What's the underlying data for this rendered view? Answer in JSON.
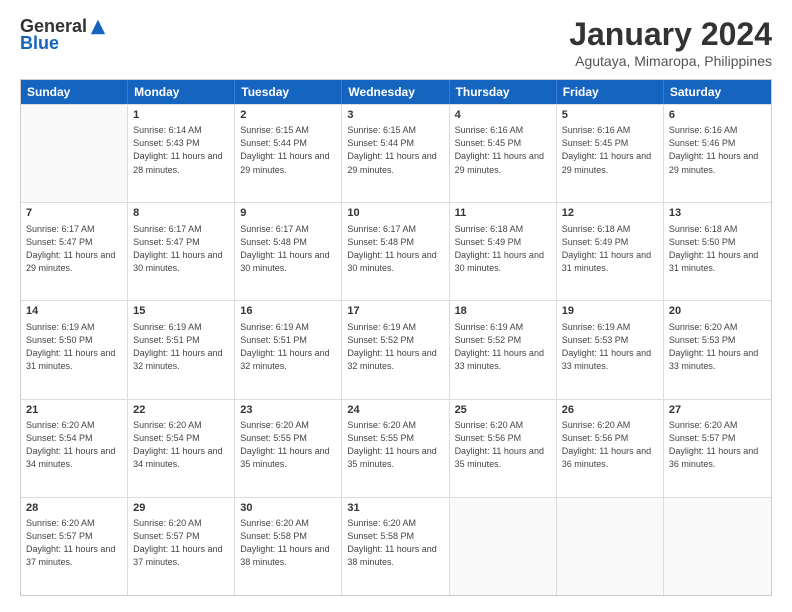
{
  "logo": {
    "general": "General",
    "blue": "Blue"
  },
  "title": "January 2024",
  "subtitle": "Agutaya, Mimaropa, Philippines",
  "header_days": [
    "Sunday",
    "Monday",
    "Tuesday",
    "Wednesday",
    "Thursday",
    "Friday",
    "Saturday"
  ],
  "weeks": [
    [
      {
        "day": "",
        "sunrise": "",
        "sunset": "",
        "daylight": ""
      },
      {
        "day": "1",
        "sunrise": "Sunrise: 6:14 AM",
        "sunset": "Sunset: 5:43 PM",
        "daylight": "Daylight: 11 hours and 28 minutes."
      },
      {
        "day": "2",
        "sunrise": "Sunrise: 6:15 AM",
        "sunset": "Sunset: 5:44 PM",
        "daylight": "Daylight: 11 hours and 29 minutes."
      },
      {
        "day": "3",
        "sunrise": "Sunrise: 6:15 AM",
        "sunset": "Sunset: 5:44 PM",
        "daylight": "Daylight: 11 hours and 29 minutes."
      },
      {
        "day": "4",
        "sunrise": "Sunrise: 6:16 AM",
        "sunset": "Sunset: 5:45 PM",
        "daylight": "Daylight: 11 hours and 29 minutes."
      },
      {
        "day": "5",
        "sunrise": "Sunrise: 6:16 AM",
        "sunset": "Sunset: 5:45 PM",
        "daylight": "Daylight: 11 hours and 29 minutes."
      },
      {
        "day": "6",
        "sunrise": "Sunrise: 6:16 AM",
        "sunset": "Sunset: 5:46 PM",
        "daylight": "Daylight: 11 hours and 29 minutes."
      }
    ],
    [
      {
        "day": "7",
        "sunrise": "Sunrise: 6:17 AM",
        "sunset": "Sunset: 5:47 PM",
        "daylight": "Daylight: 11 hours and 29 minutes."
      },
      {
        "day": "8",
        "sunrise": "Sunrise: 6:17 AM",
        "sunset": "Sunset: 5:47 PM",
        "daylight": "Daylight: 11 hours and 30 minutes."
      },
      {
        "day": "9",
        "sunrise": "Sunrise: 6:17 AM",
        "sunset": "Sunset: 5:48 PM",
        "daylight": "Daylight: 11 hours and 30 minutes."
      },
      {
        "day": "10",
        "sunrise": "Sunrise: 6:17 AM",
        "sunset": "Sunset: 5:48 PM",
        "daylight": "Daylight: 11 hours and 30 minutes."
      },
      {
        "day": "11",
        "sunrise": "Sunrise: 6:18 AM",
        "sunset": "Sunset: 5:49 PM",
        "daylight": "Daylight: 11 hours and 30 minutes."
      },
      {
        "day": "12",
        "sunrise": "Sunrise: 6:18 AM",
        "sunset": "Sunset: 5:49 PM",
        "daylight": "Daylight: 11 hours and 31 minutes."
      },
      {
        "day": "13",
        "sunrise": "Sunrise: 6:18 AM",
        "sunset": "Sunset: 5:50 PM",
        "daylight": "Daylight: 11 hours and 31 minutes."
      }
    ],
    [
      {
        "day": "14",
        "sunrise": "Sunrise: 6:19 AM",
        "sunset": "Sunset: 5:50 PM",
        "daylight": "Daylight: 11 hours and 31 minutes."
      },
      {
        "day": "15",
        "sunrise": "Sunrise: 6:19 AM",
        "sunset": "Sunset: 5:51 PM",
        "daylight": "Daylight: 11 hours and 32 minutes."
      },
      {
        "day": "16",
        "sunrise": "Sunrise: 6:19 AM",
        "sunset": "Sunset: 5:51 PM",
        "daylight": "Daylight: 11 hours and 32 minutes."
      },
      {
        "day": "17",
        "sunrise": "Sunrise: 6:19 AM",
        "sunset": "Sunset: 5:52 PM",
        "daylight": "Daylight: 11 hours and 32 minutes."
      },
      {
        "day": "18",
        "sunrise": "Sunrise: 6:19 AM",
        "sunset": "Sunset: 5:52 PM",
        "daylight": "Daylight: 11 hours and 33 minutes."
      },
      {
        "day": "19",
        "sunrise": "Sunrise: 6:19 AM",
        "sunset": "Sunset: 5:53 PM",
        "daylight": "Daylight: 11 hours and 33 minutes."
      },
      {
        "day": "20",
        "sunrise": "Sunrise: 6:20 AM",
        "sunset": "Sunset: 5:53 PM",
        "daylight": "Daylight: 11 hours and 33 minutes."
      }
    ],
    [
      {
        "day": "21",
        "sunrise": "Sunrise: 6:20 AM",
        "sunset": "Sunset: 5:54 PM",
        "daylight": "Daylight: 11 hours and 34 minutes."
      },
      {
        "day": "22",
        "sunrise": "Sunrise: 6:20 AM",
        "sunset": "Sunset: 5:54 PM",
        "daylight": "Daylight: 11 hours and 34 minutes."
      },
      {
        "day": "23",
        "sunrise": "Sunrise: 6:20 AM",
        "sunset": "Sunset: 5:55 PM",
        "daylight": "Daylight: 11 hours and 35 minutes."
      },
      {
        "day": "24",
        "sunrise": "Sunrise: 6:20 AM",
        "sunset": "Sunset: 5:55 PM",
        "daylight": "Daylight: 11 hours and 35 minutes."
      },
      {
        "day": "25",
        "sunrise": "Sunrise: 6:20 AM",
        "sunset": "Sunset: 5:56 PM",
        "daylight": "Daylight: 11 hours and 35 minutes."
      },
      {
        "day": "26",
        "sunrise": "Sunrise: 6:20 AM",
        "sunset": "Sunset: 5:56 PM",
        "daylight": "Daylight: 11 hours and 36 minutes."
      },
      {
        "day": "27",
        "sunrise": "Sunrise: 6:20 AM",
        "sunset": "Sunset: 5:57 PM",
        "daylight": "Daylight: 11 hours and 36 minutes."
      }
    ],
    [
      {
        "day": "28",
        "sunrise": "Sunrise: 6:20 AM",
        "sunset": "Sunset: 5:57 PM",
        "daylight": "Daylight: 11 hours and 37 minutes."
      },
      {
        "day": "29",
        "sunrise": "Sunrise: 6:20 AM",
        "sunset": "Sunset: 5:57 PM",
        "daylight": "Daylight: 11 hours and 37 minutes."
      },
      {
        "day": "30",
        "sunrise": "Sunrise: 6:20 AM",
        "sunset": "Sunset: 5:58 PM",
        "daylight": "Daylight: 11 hours and 38 minutes."
      },
      {
        "day": "31",
        "sunrise": "Sunrise: 6:20 AM",
        "sunset": "Sunset: 5:58 PM",
        "daylight": "Daylight: 11 hours and 38 minutes."
      },
      {
        "day": "",
        "sunrise": "",
        "sunset": "",
        "daylight": ""
      },
      {
        "day": "",
        "sunrise": "",
        "sunset": "",
        "daylight": ""
      },
      {
        "day": "",
        "sunrise": "",
        "sunset": "",
        "daylight": ""
      }
    ]
  ]
}
